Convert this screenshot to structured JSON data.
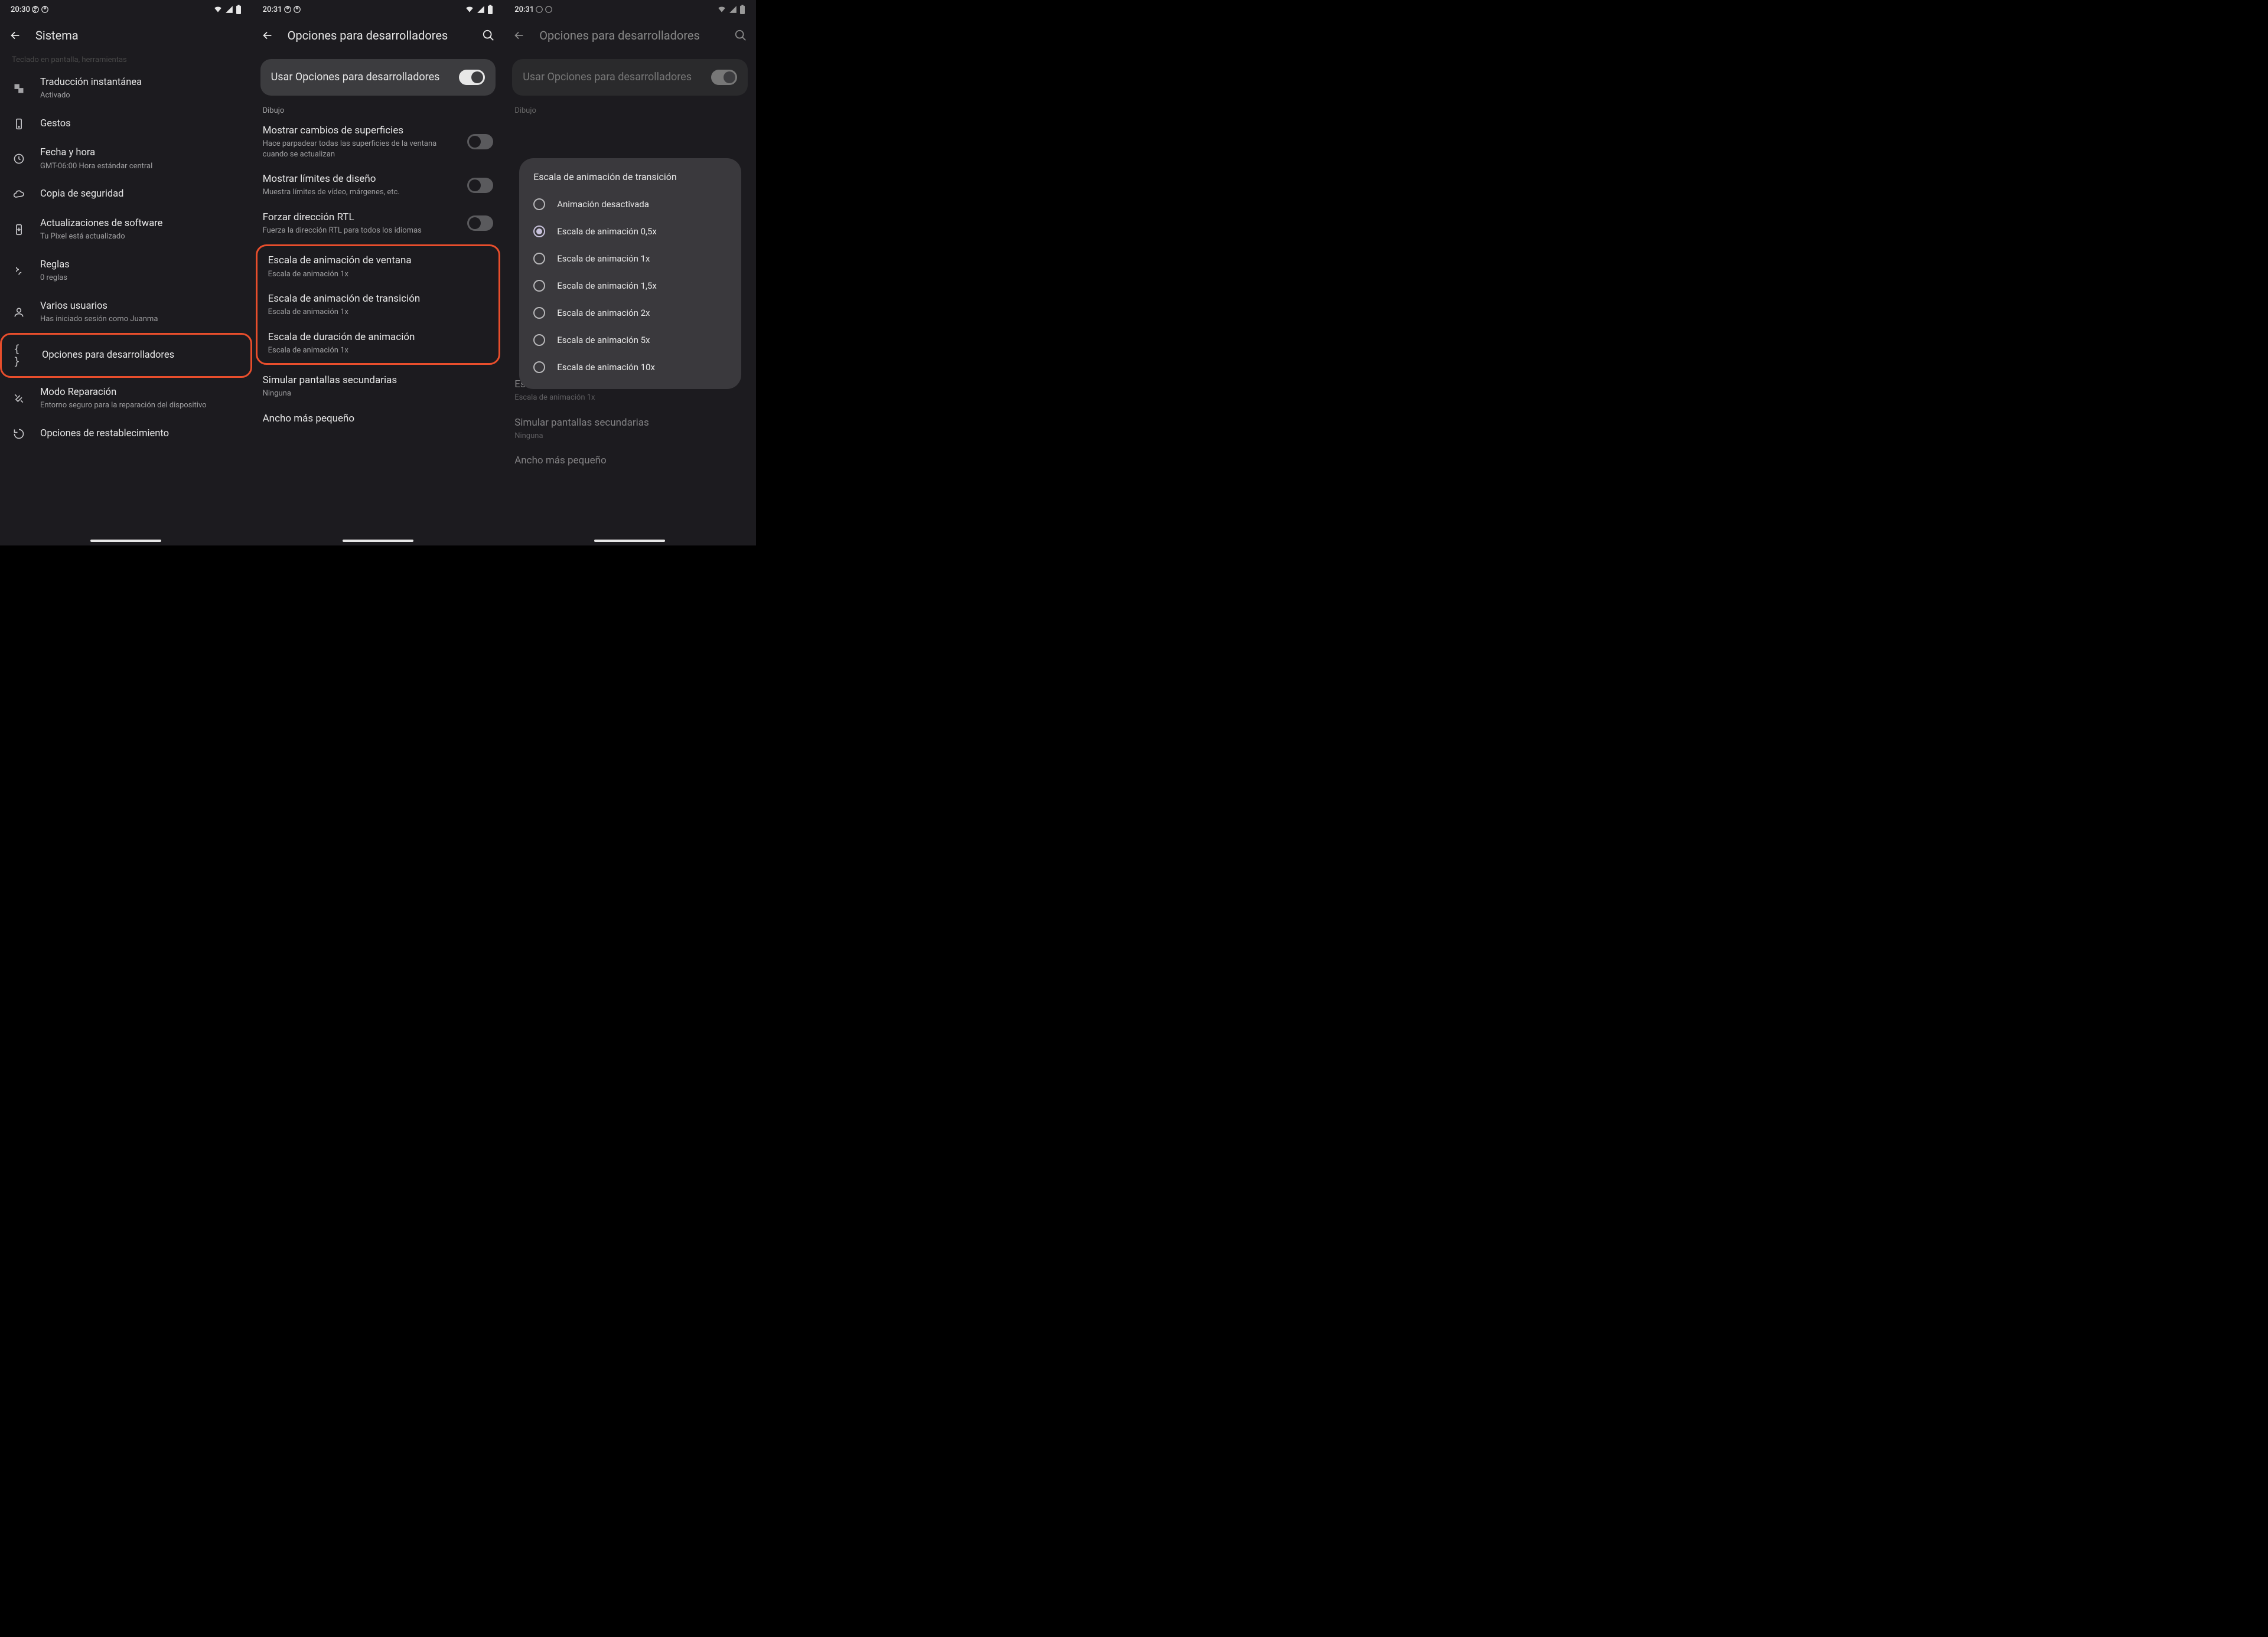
{
  "p1": {
    "time": "20:30",
    "header": "Sistema",
    "truncated": "…",
    "rows": [
      {
        "icon": "translate",
        "primary": "Traducción instantánea",
        "secondary": "Activado"
      },
      {
        "icon": "gesture",
        "primary": "Gestos",
        "secondary": null
      },
      {
        "icon": "clock",
        "primary": "Fecha y hora",
        "secondary": "GMT-06:00 Hora estándar central"
      },
      {
        "icon": "cloud",
        "primary": "Copia de seguridad",
        "secondary": null
      },
      {
        "icon": "update",
        "primary": "Actualizaciones de software",
        "secondary": "Tu Pixel está actualizado"
      },
      {
        "icon": "rules",
        "primary": "Reglas",
        "secondary": "0 reglas"
      },
      {
        "icon": "users",
        "primary": "Varios usuarios",
        "secondary": "Has iniciado sesión como Juanma"
      },
      {
        "icon": "braces",
        "primary": "Opciones para desarrolladores",
        "secondary": null,
        "hl": true
      },
      {
        "icon": "repair",
        "primary": "Modo Reparación",
        "secondary": "Entorno seguro para la reparación del dispositivo"
      },
      {
        "icon": "reset",
        "primary": "Opciones de restablecimiento",
        "secondary": null
      }
    ]
  },
  "p2": {
    "time": "20:31",
    "header": "Opciones para desarrolladores",
    "card": "Usar Opciones para desarrolladores",
    "section": "Dibujo",
    "rows": [
      {
        "primary": "Mostrar cambios de superficies",
        "secondary": "Hace parpadear todas las superficies de la ventana cuando se actualizan",
        "toggle": "off"
      },
      {
        "primary": "Mostrar límites de diseño",
        "secondary": "Muestra límites de vídeo, márgenes, etc.",
        "toggle": "off"
      },
      {
        "primary": "Forzar dirección RTL",
        "secondary": "Fuerza la dirección RTL para todos los idiomas",
        "toggle": "off"
      }
    ],
    "hlrows": [
      {
        "primary": "Escala de animación de ventana",
        "secondary": "Escala de animación 1x"
      },
      {
        "primary": "Escala de animación de transición",
        "secondary": "Escala de animación 1x"
      },
      {
        "primary": "Escala de duración de animación",
        "secondary": "Escala de animación 1x"
      }
    ],
    "rows2": [
      {
        "primary": "Simular pantallas secundarias",
        "secondary": "Ninguna"
      },
      {
        "primary": "Ancho más pequeño",
        "secondary": null
      }
    ]
  },
  "p3": {
    "time": "20:31",
    "header": "Opciones para desarrolladores",
    "card": "Usar Opciones para desarrolladores",
    "section": "Dibujo",
    "dialog": {
      "title": "Escala de animación de transición",
      "options": [
        "Animación desactivada",
        "Escala de animación 0,5x",
        "Escala de animación 1x",
        "Escala de animación 1,5x",
        "Escala de animación 2x",
        "Escala de animación 5x",
        "Escala de animación 10x"
      ],
      "selected": 1
    },
    "below": [
      {
        "primary": "Escala de duración de animación",
        "secondary": "Escala de animación 1x"
      },
      {
        "primary": "Simular pantallas secundarias",
        "secondary": "Ninguna"
      },
      {
        "primary": "Ancho más pequeño",
        "secondary": null
      }
    ]
  }
}
